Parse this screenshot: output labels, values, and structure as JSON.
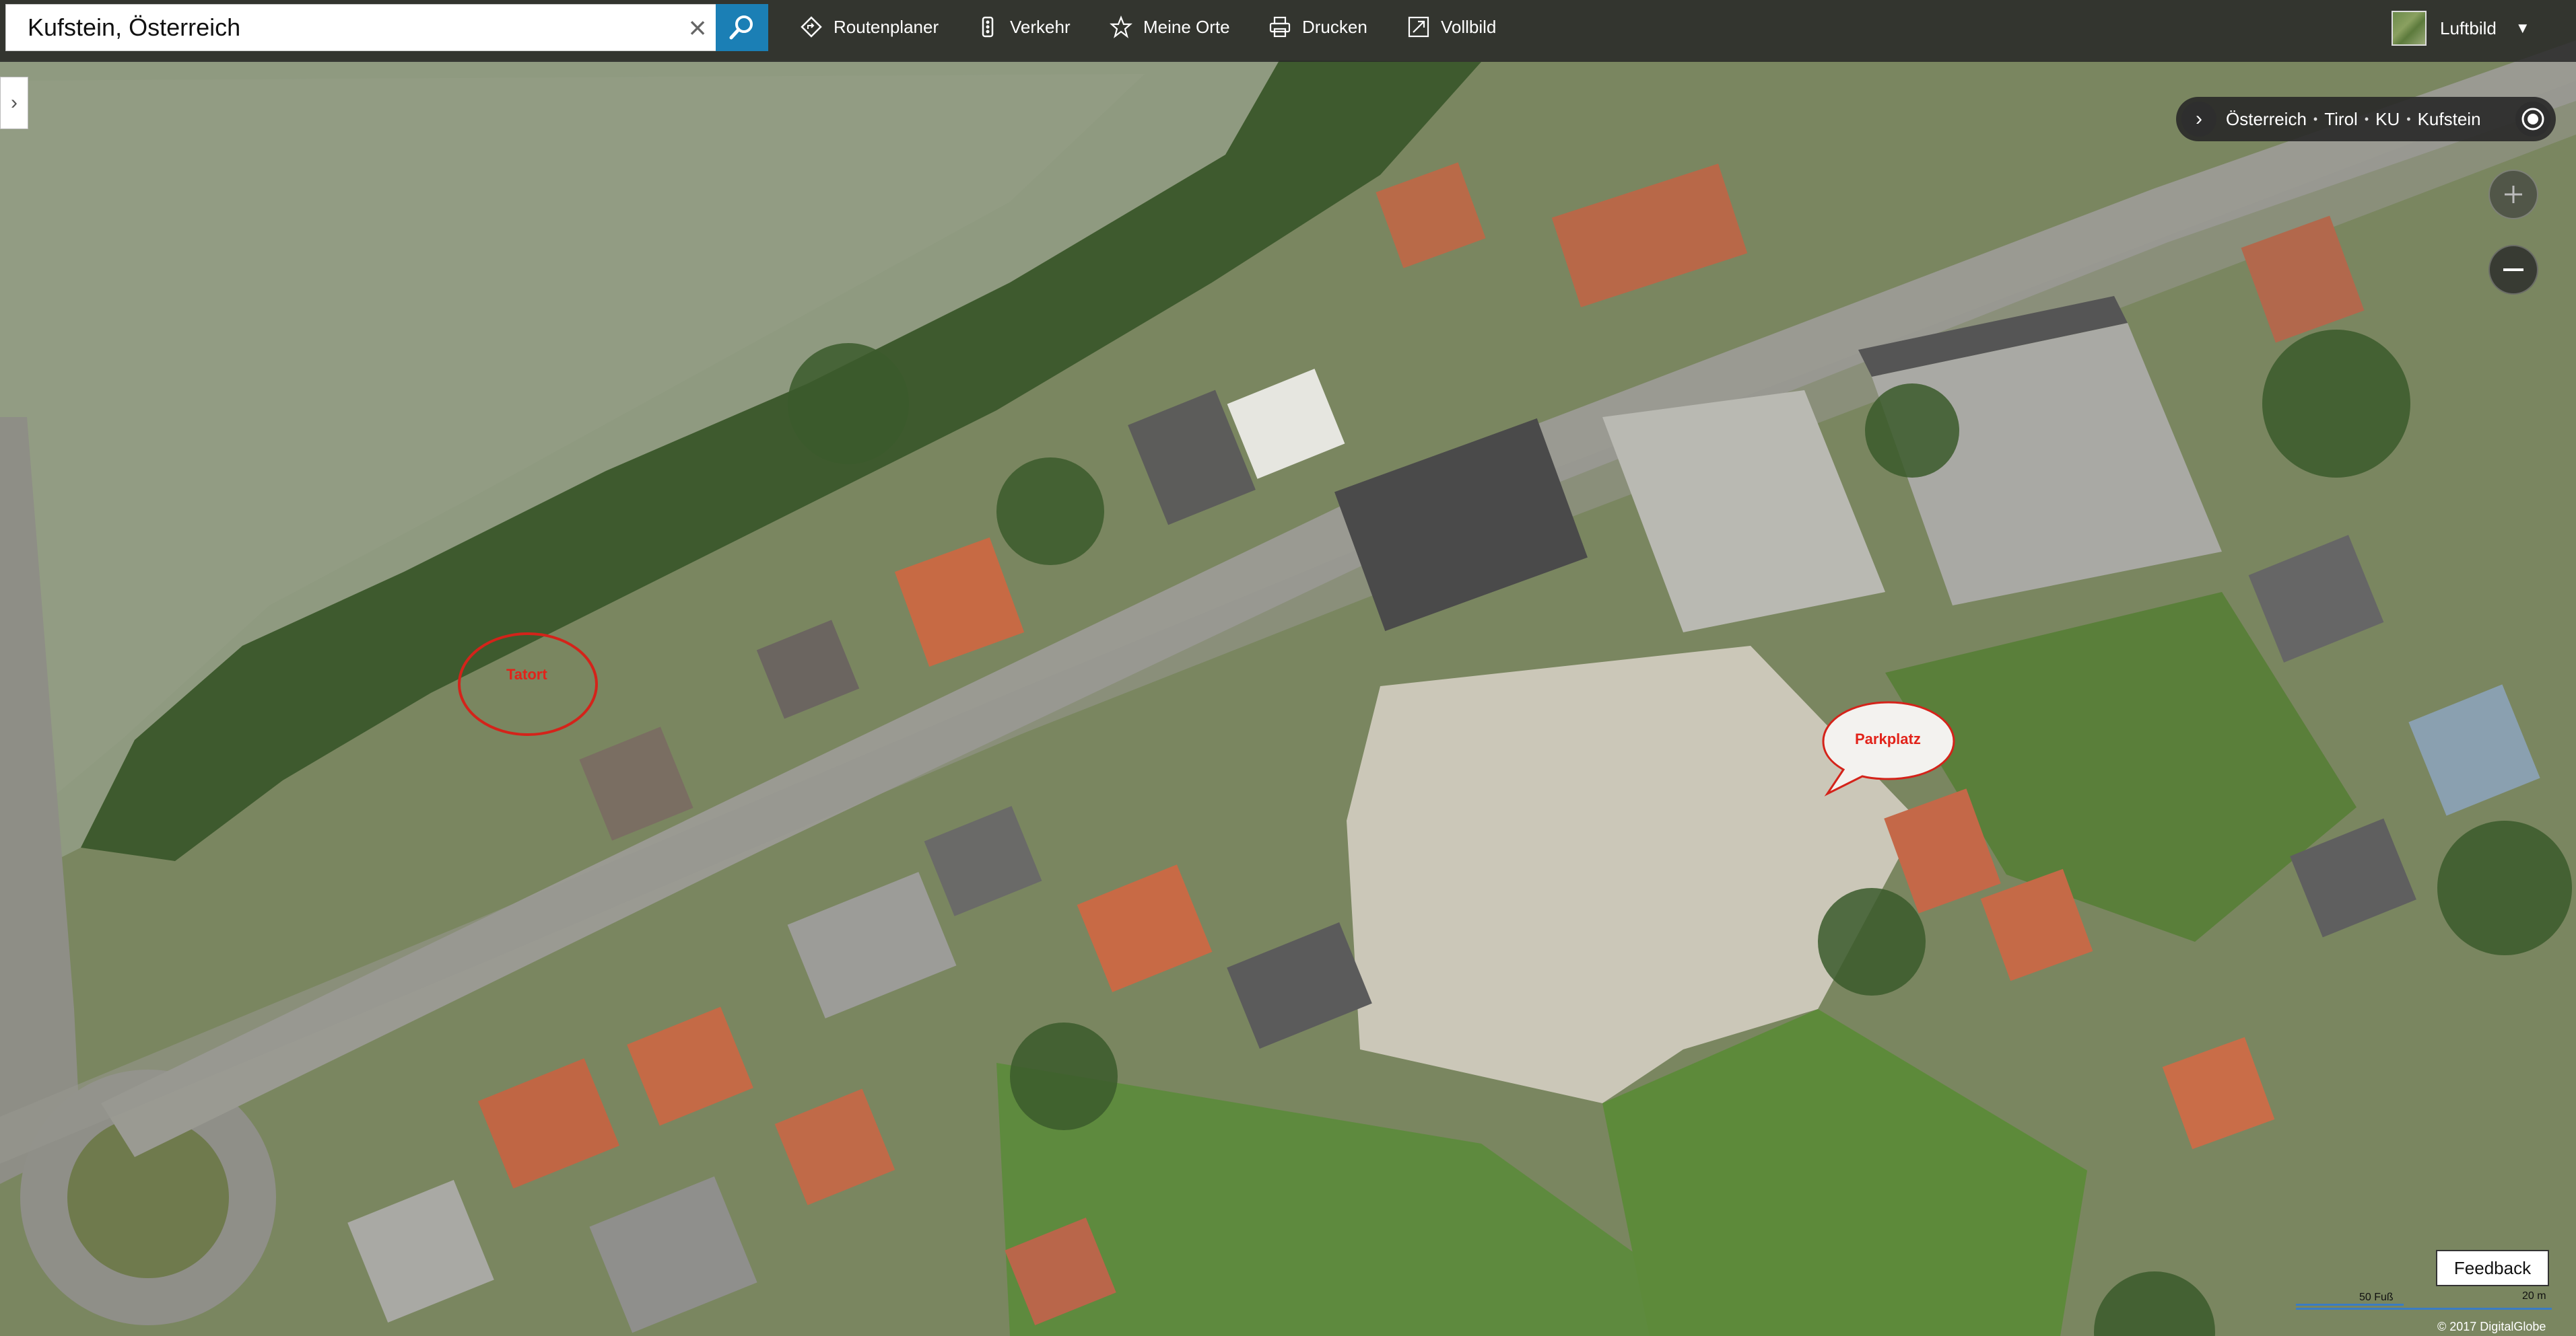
{
  "search": {
    "value": "Kufstein, Österreich"
  },
  "nav": {
    "route": "Routenplaner",
    "traffic": "Verkehr",
    "places": "Meine Orte",
    "print": "Drucken",
    "fullscreen": "Vollbild"
  },
  "layer": {
    "label": "Luftbild"
  },
  "breadcrumb": [
    "Österreich",
    "Tirol",
    "KU",
    "Kufstein"
  ],
  "annotations": {
    "tatort": "Tatort",
    "parkplatz": "Parkplatz"
  },
  "footer": {
    "feedback": "Feedback",
    "scale_feet": "50 Fuß",
    "scale_meters": "20 m",
    "copyright": "© 2017 DigitalGlobe"
  },
  "colors": {
    "accent": "#1b7fb5",
    "annotation": "#e2231a"
  }
}
